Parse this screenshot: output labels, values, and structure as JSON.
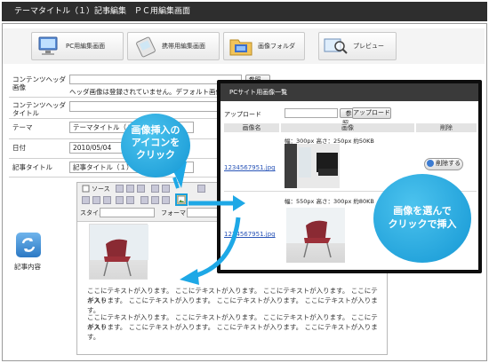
{
  "title": "テーマタイトル（１）記事編集　ＰＣ用編集画面",
  "nav": {
    "pc_edit": "PC用編集画面",
    "mobile_edit": "携帯用編集画面",
    "image_folder": "画像フォルダ",
    "preview": "プレビュー"
  },
  "form": {
    "header_image_label": "コンテンツヘッダ画像",
    "header_image_status": "ヘッダ画像は登録されていません。デフォルト画像が",
    "browse_label": "参照...",
    "header_title_label": "コンテンツヘッダタイトル",
    "theme_label": "テーマ",
    "theme_value": "テーマタイトル（１）",
    "date_label": "日付",
    "date_value": "2010/05/04",
    "article_title_label": "記事タイトル",
    "article_title_value": "記事タイトル（１）",
    "article_body_label": "記事内容"
  },
  "editor": {
    "source_label": "ソース",
    "style_label": "スタイル",
    "format_label": "フォーマット",
    "body_lines": [
      "ここにテキストが入ります。 ここにテキストが入ります。 ここにテキストが入ります。 ここにテキスト",
      "が入ります。 ここにテキストが入ります。 ここにテキストが入ります。 ここにテキストが入ります。",
      "ここにテキストが入ります。 ここにテキストが入ります。 ここにテキストが入ります。 ここにテキスト",
      "が入ります。 ここにテキストが入ります。 ここにテキストが入ります。 ここにテキストが入ります。"
    ]
  },
  "popup": {
    "title": "PCサイト用画像一覧",
    "upload_label": "アップロード",
    "browse_label": "参照...",
    "upload_button": "アップロード",
    "col_name": "画像名",
    "col_image": "画像",
    "col_delete": "削除",
    "rows": [
      {
        "file": "1234567951.jpg",
        "info": "幅：300px 高さ：250px 約50KB",
        "delete": "削除する"
      },
      {
        "file": "1234567951.jpg",
        "info": "幅：550px 高さ：300px 約80KB",
        "delete": ""
      }
    ]
  },
  "callouts": {
    "insert_line1": "画像挿入の",
    "insert_line2": "アイコンを",
    "insert_line3": "クリック",
    "select_line1": "画像を選んで",
    "select_line2": "クリックで挿入"
  },
  "colors": {
    "accent": "#1497d4",
    "titlebar": "#2e2e2e"
  }
}
